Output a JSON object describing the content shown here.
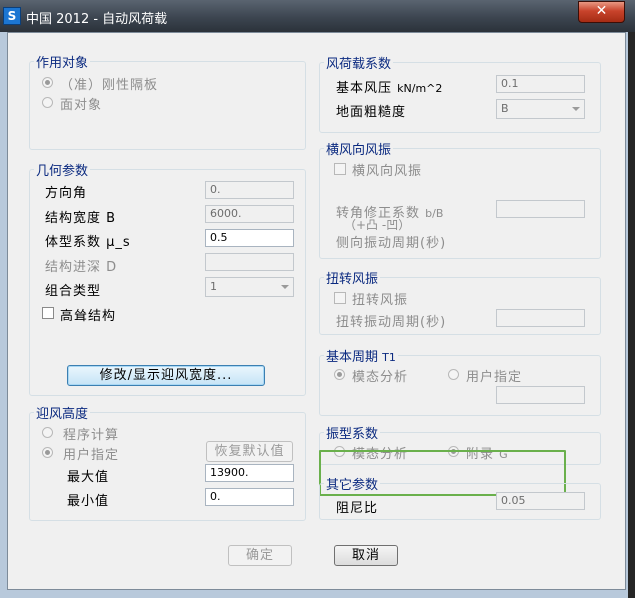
{
  "window": {
    "app_icon": "S",
    "title": "中国 2012 - 自动风荷载",
    "close_glyph": "✕"
  },
  "group_object": {
    "legend": "作用对象",
    "opt_rigid": "（准）刚性隔板",
    "opt_face": "面对象",
    "selected": "（准）刚性隔板"
  },
  "group_geometry": {
    "legend": "几何参数",
    "direction_label": "方向角",
    "direction_value": "0.",
    "width_label": "结构宽度 B",
    "width_value": "6000.",
    "shape_label": "体型系数 μ_s",
    "shape_value": "0.5",
    "depth_label": "结构进深 D",
    "depth_value": "",
    "combo_label": "组合类型",
    "combo_value": "1",
    "tall_label": "高耸结构",
    "modify_button": "修改/显示迎风宽度..."
  },
  "group_height": {
    "legend": "迎风高度",
    "opt_program": "程序计算",
    "opt_user": "用户指定",
    "selected": "用户指定",
    "restore_button": "恢复默认值",
    "max_label": "最大值",
    "max_value": "13900.",
    "min_label": "最小值",
    "min_value": "0."
  },
  "group_wind_load": {
    "legend": "风荷载系数",
    "pressure_label": "基本风压",
    "pressure_unit": "kN/m^2",
    "pressure_value": "0.1",
    "roughness_label": "地面粗糙度",
    "roughness_value": "B"
  },
  "group_crosswind": {
    "legend": "横风向风振",
    "check_label": "横风向风振",
    "corner_label": "转角修正系数",
    "corner_unit": "b/B",
    "corner_hint": "（+凸 -凹）",
    "period_label": "侧向振动周期(秒)",
    "corner_value": ""
  },
  "group_torsion": {
    "legend": "扭转风振",
    "check_label": "扭转风振",
    "period_label": "扭转振动周期(秒)",
    "period_value": ""
  },
  "group_period": {
    "legend": "基本周期",
    "legend_unit": "T1",
    "opt_modal": "模态分析",
    "opt_user": "用户指定",
    "selected": "模态分析",
    "value": ""
  },
  "group_mode_coef": {
    "legend": "振型系数",
    "opt_modal": "模态分析",
    "opt_appendix": "附录",
    "appendix_suffix": "G",
    "selected": "附录G"
  },
  "group_other": {
    "legend": "其它参数",
    "damping_label": "阻尼比",
    "damping_value": "0.05"
  },
  "footer": {
    "ok_button": "确定",
    "cancel_button": "取消"
  },
  "colors": {
    "legend_blue": "#0b2a80",
    "highlight_green": "#6ab04c",
    "title_bar": "#3c4550"
  }
}
